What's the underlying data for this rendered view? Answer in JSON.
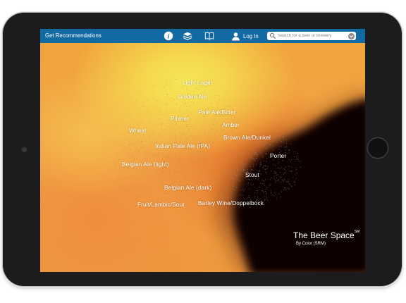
{
  "topbar": {
    "get_recommendations": "Get Recommendations",
    "login_label": "Log In",
    "icons": [
      "info-icon",
      "layers-icon",
      "book-icon",
      "user-icon",
      "search-icon",
      "chevron-down-icon"
    ]
  },
  "search": {
    "placeholder": "Search for a beer or brewery"
  },
  "map": {
    "styles": [
      "Light Lager",
      "Golden Ale",
      "Pale Ale/Bitter",
      "Pilsner",
      "Amber",
      "Wheat",
      "Brown Ale/Dunkel",
      "Indian Pale Ale (IPA)",
      "Porter",
      "Belgian Ale (light)",
      "Stout",
      "Belgian Ale (dark)",
      "Fruit/Lambic/Sour",
      "Barley Wine/Doppelbock"
    ],
    "title": "The Beer Space",
    "title_mark": "SM",
    "subtitle": "By Color (SRM)"
  },
  "colors": {
    "topbar": "#126aa3",
    "light_region": "#f6e655",
    "mid_region": "#f3a63b",
    "dark_region": "#000000",
    "frame": "#1c1c1e"
  }
}
